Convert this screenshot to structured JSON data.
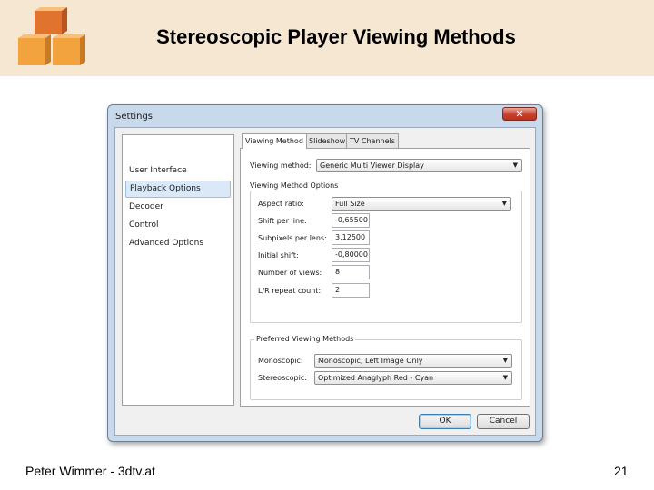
{
  "slide": {
    "title": "Stereoscopic Player Viewing Methods",
    "footer_left": "Peter Wimmer - 3dtv.at",
    "page_number": "21",
    "logo_icon": "stacked-cubes-icon",
    "colors": {
      "header_bg": "#f5e7d2",
      "cube_light": "#f3a33e",
      "cube_dark": "#d9632a"
    }
  },
  "dialog": {
    "title": "Settings",
    "close_label": "✕",
    "nav": [
      {
        "label": "User Interface",
        "selected": false
      },
      {
        "label": "Playback Options",
        "selected": true
      },
      {
        "label": "Decoder",
        "selected": false
      },
      {
        "label": "Control",
        "selected": false
      },
      {
        "label": "Advanced Options",
        "selected": false
      }
    ],
    "tabs": [
      {
        "label": "Viewing Method",
        "active": true
      },
      {
        "label": "Slideshow",
        "active": false
      },
      {
        "label": "TV Channels",
        "active": false
      }
    ],
    "viewing_method": {
      "label": "Viewing method:",
      "value": "Generic Multi Viewer Display"
    },
    "options_group": {
      "title": "Viewing Method Options",
      "aspect_ratio": {
        "label": "Aspect ratio:",
        "value": "Full Size"
      },
      "shift_per_line": {
        "label": "Shift per line:",
        "value": "-0,65500"
      },
      "subpixels_per_lens": {
        "label": "Subpixels per lens:",
        "value": "3,12500"
      },
      "initial_shift": {
        "label": "Initial shift:",
        "value": "-0,80000"
      },
      "number_of_views": {
        "label": "Number of views:",
        "value": "8"
      },
      "lr_repeat_count": {
        "label": "L/R repeat count:",
        "value": "2"
      }
    },
    "preferred_group": {
      "title": "Preferred Viewing Methods",
      "monoscopic": {
        "label": "Monoscopic:",
        "value": "Monoscopic, Left Image Only"
      },
      "stereoscopic": {
        "label": "Stereoscopic:",
        "value": "Optimized Anaglyph Red - Cyan"
      }
    },
    "ok_label": "OK",
    "cancel_label": "Cancel"
  }
}
